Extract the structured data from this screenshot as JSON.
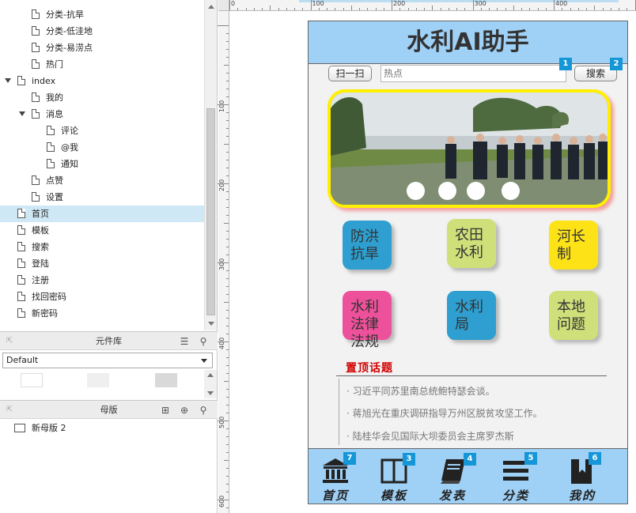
{
  "tree": {
    "items": [
      {
        "label": "分类-抗旱"
      },
      {
        "label": "分类-低洼地"
      },
      {
        "label": "分类-易涝点"
      },
      {
        "label": "热门"
      },
      {
        "label": "index"
      },
      {
        "label": "我的"
      },
      {
        "label": "消息"
      },
      {
        "label": "评论"
      },
      {
        "label": "@我"
      },
      {
        "label": "通知"
      },
      {
        "label": "点赞"
      },
      {
        "label": "设置"
      },
      {
        "label": "首页"
      },
      {
        "label": "模板"
      },
      {
        "label": "搜索"
      },
      {
        "label": "登陆"
      },
      {
        "label": "注册"
      },
      {
        "label": "找回密码"
      },
      {
        "label": "新密码"
      }
    ]
  },
  "library_panel": {
    "title": "元件库",
    "select_value": "Default"
  },
  "master_panel": {
    "title": "母版",
    "item": "新母版 2"
  },
  "ruler": {
    "top_labels": [
      "0",
      "100",
      "200",
      "300",
      "400"
    ],
    "left_labels": [
      "100",
      "200",
      "300",
      "400",
      "500",
      "600"
    ]
  },
  "phone": {
    "title": "水利AI助手",
    "scan_label": "扫一扫",
    "search_placeholder": "热点",
    "search_label": "搜索",
    "badges": [
      "1",
      "2",
      "3",
      "4",
      "5",
      "6",
      "7"
    ],
    "tiles": [
      {
        "label": "防洪\n抗旱",
        "color": "#2e9fd0"
      },
      {
        "label": "农田\n水利",
        "color": "#cfe07a"
      },
      {
        "label": "河长\n制",
        "color": "#fde218"
      },
      {
        "label": "水利\n法律\n法规",
        "color": "#ee519b"
      },
      {
        "label": "水利\n局",
        "color": "#2e9fd0"
      },
      {
        "label": "本地\n问题",
        "color": "#cfe07a"
      }
    ],
    "topics_title": "置顶话题",
    "topics": [
      "· 习近平同苏里南总统鲍特瑟会谈。",
      "· 蒋旭光在重庆调研指导万州区脱贫攻坚工作。",
      "· 陆桂华会见国际大坝委员会主席罗杰斯"
    ],
    "tabs": [
      {
        "label": "首页",
        "icon": "bank-icon"
      },
      {
        "label": "模板",
        "icon": "book-open-icon"
      },
      {
        "label": "发表",
        "icon": "book-icon"
      },
      {
        "label": "分类",
        "icon": "menu-icon"
      },
      {
        "label": "我的",
        "icon": "bookmark-icon"
      }
    ],
    "header_color": "#9fd0f5",
    "banner_border_color": "#ffef00",
    "topics_title_color": "#d10000"
  }
}
